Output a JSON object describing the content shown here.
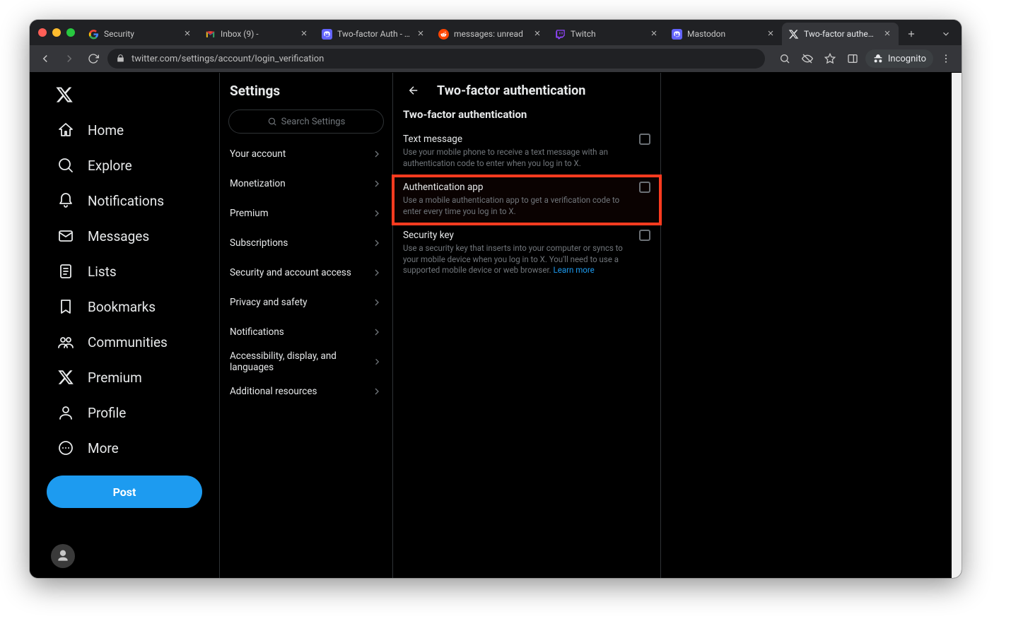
{
  "browser": {
    "tabs": [
      {
        "favicon": "google",
        "title": "Security"
      },
      {
        "favicon": "gmail",
        "title": "Inbox (9) -"
      },
      {
        "favicon": "mastodon",
        "title": "Two-factor Auth - Masto…"
      },
      {
        "favicon": "reddit",
        "title": "messages: unread"
      },
      {
        "favicon": "twitch",
        "title": "Twitch"
      },
      {
        "favicon": "mastodon",
        "title": "Mastodon"
      },
      {
        "favicon": "x",
        "title": "Two-factor authenticatio…",
        "active": true
      }
    ],
    "url": "twitter.com/settings/account/login_verification",
    "incognito_label": "Incognito"
  },
  "nav": {
    "items": [
      {
        "icon": "home",
        "label": "Home"
      },
      {
        "icon": "explore",
        "label": "Explore"
      },
      {
        "icon": "bell",
        "label": "Notifications"
      },
      {
        "icon": "mail",
        "label": "Messages"
      },
      {
        "icon": "list",
        "label": "Lists"
      },
      {
        "icon": "bookmark",
        "label": "Bookmarks"
      },
      {
        "icon": "communities",
        "label": "Communities"
      },
      {
        "icon": "x",
        "label": "Premium"
      },
      {
        "icon": "profile",
        "label": "Profile"
      },
      {
        "icon": "more",
        "label": "More"
      }
    ],
    "post_label": "Post"
  },
  "settings_col": {
    "title": "Settings",
    "search_placeholder": "Search Settings",
    "rows": [
      "Your account",
      "Monetization",
      "Premium",
      "Subscriptions",
      "Security and account access",
      "Privacy and safety",
      "Notifications",
      "Accessibility, display, and languages",
      "Additional resources"
    ]
  },
  "main": {
    "header": "Two-factor authentication",
    "section_title": "Two-factor authentication",
    "options": [
      {
        "name": "Text message",
        "desc": "Use your mobile phone to receive a text message with an authentication code to enter when you log in to X."
      },
      {
        "name": "Authentication app",
        "desc": "Use a mobile authentication app to get a verification code to enter every time you log in to X.",
        "highlight": true
      },
      {
        "name": "Security key",
        "desc": "Use a security key that inserts into your computer or syncs to your mobile device when you log in to X. You'll need to use a supported mobile device or web browser.",
        "learn_more": "Learn more"
      }
    ]
  }
}
